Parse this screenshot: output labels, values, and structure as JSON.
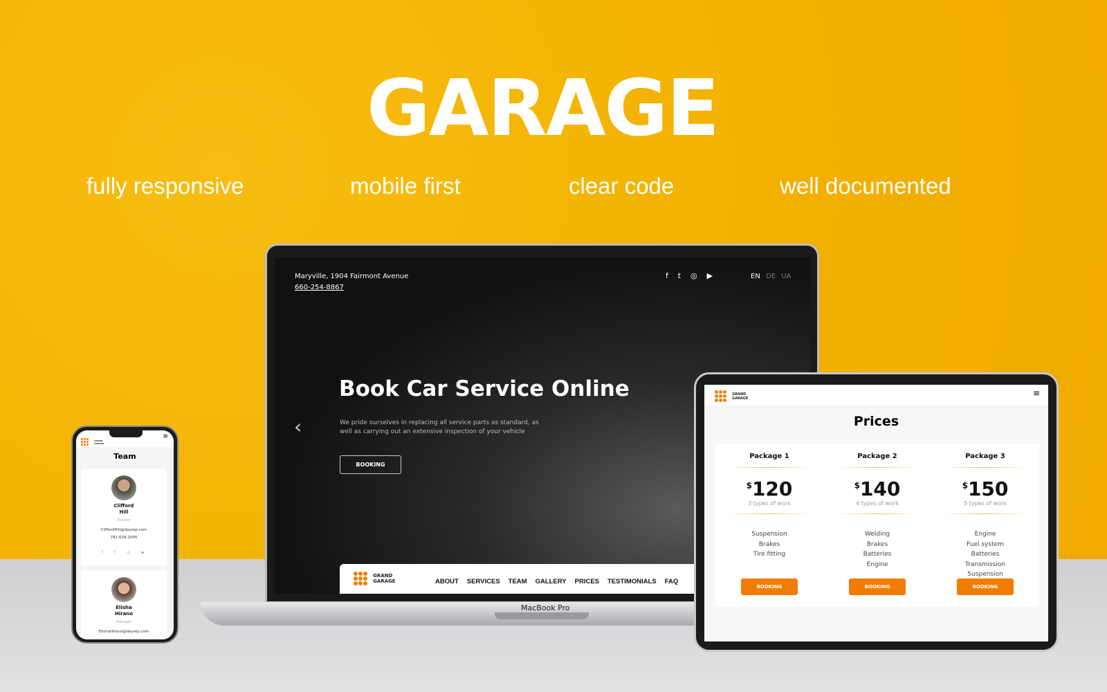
{
  "hero": {
    "title": "GARAGE",
    "taglines": [
      "fully responsive",
      "mobile first",
      "clear code",
      "well documented"
    ]
  },
  "colors": {
    "background": "#F5B400",
    "accent": "#F07D00"
  },
  "laptop": {
    "model_label": "MacBook Pro",
    "topbar": {
      "address": "Maryville, 1904 Fairmont Avenue",
      "phone": "660-254-8867",
      "social_icons": [
        "facebook-icon",
        "twitter-icon",
        "instagram-icon",
        "youtube-icon"
      ],
      "languages": [
        "EN",
        "DE",
        "UA"
      ],
      "active_language": "EN"
    },
    "hero": {
      "heading": "Book Car Service Online",
      "text": "We pride ourselves in replacing all service parts as standard, as well as carrying out an extensive inspection of your vehicle",
      "button": "BOOKING"
    },
    "nav": {
      "logo": [
        "GRAND",
        "GARAGE"
      ],
      "links": [
        "ABOUT",
        "SERVICES",
        "TEAM",
        "GALLERY",
        "PRICES",
        "TESTIMONIALS",
        "FAQ"
      ]
    }
  },
  "tablet": {
    "logo": [
      "GRAND",
      "GARAGE"
    ],
    "title": "Prices",
    "packages": [
      {
        "name": "Package 1",
        "currency": "$",
        "price": "120",
        "types": "3 types of work",
        "features": [
          "Suspension",
          "Brakes",
          "Tire fitting"
        ],
        "button": "BOOKING"
      },
      {
        "name": "Package 2",
        "currency": "$",
        "price": "140",
        "types": "4 types of work",
        "features": [
          "Welding",
          "Brakes",
          "Batteries",
          "Engine"
        ],
        "button": "BOOKING"
      },
      {
        "name": "Package 3",
        "currency": "$",
        "price": "150",
        "types": "5 types of work",
        "features": [
          "Engine",
          "Fuel system",
          "Batteries",
          "Transmission",
          "Suspension"
        ],
        "button": "BOOKING"
      }
    ]
  },
  "phone": {
    "logo": [
      "GRAND",
      "GARAGE"
    ],
    "title": "Team",
    "members": [
      {
        "name_line1": "Clifford",
        "name_line2": "Hill",
        "role": "Director",
        "email": "CliffordHill@dayrep.com",
        "phone": "781-639-2095"
      },
      {
        "name_line1": "Elisha",
        "name_line2": "Hirano",
        "role": "Manager",
        "email": "ElishaHirano@dayrep.com"
      }
    ]
  }
}
